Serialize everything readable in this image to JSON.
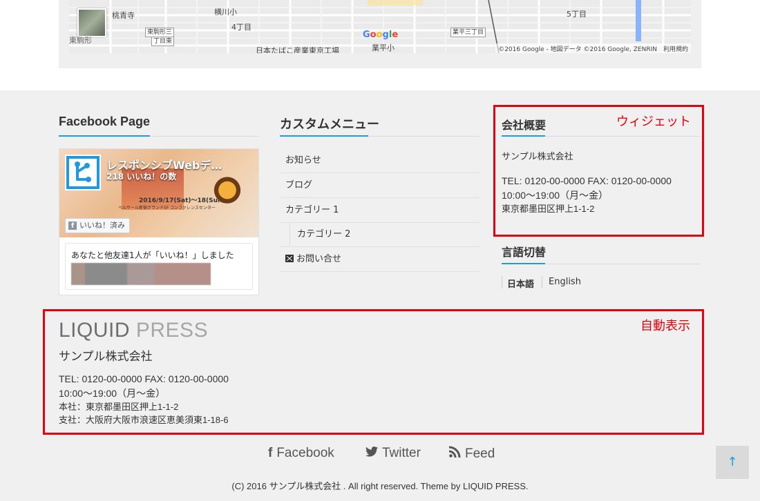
{
  "map": {
    "labels": {
      "momoaoji": "桃青寺",
      "yokokawa_sho": "横川小",
      "higashikomagata3": "東駒形三",
      "chome_higashi": "丁目東",
      "yonchome": "4丁目",
      "higashikomagata": "東駒形",
      "tobacco_factory": "日本たばこ産業東京工場",
      "gyohei_sho": "業平小",
      "gohchome": "5丁目",
      "gyohei3": "業平三丁目"
    },
    "google_logo": "Google",
    "copyright": "©2016 Google - 地図データ ©2016 Google, ZENRIN　利用規約",
    "zoom_in": "+",
    "zoom_out": "−"
  },
  "facebook_widget": {
    "title": "Facebook Page",
    "page_name": "レスポンシブWebデ…",
    "likes": "218 いいね！の数",
    "event_date": "2016/9/17(Sat)～18(Sun)",
    "event_venue": "ベルサール新宿グランド5F コンファレンスセンター",
    "like_button": "いいね！済み",
    "friends_text": "あなたと他友達1人が「いいね！」しました"
  },
  "custom_menu": {
    "title": "カスタムメニュー",
    "items": [
      "お知らせ",
      "ブログ",
      "カテゴリー 1",
      "カテゴリー 2",
      "お問い合せ"
    ]
  },
  "company_widget": {
    "title": "会社概要",
    "name": "サンプル株式会社",
    "tel_fax": "TEL: 0120-00-0000 FAX: 0120-00-0000",
    "hours": "10:00〜19:00（月〜金）",
    "address": "東京都墨田区押上1-1-2",
    "annotation": "ウィジェット"
  },
  "language_widget": {
    "title": "言語切替",
    "languages": [
      "日本語",
      "English"
    ]
  },
  "auto_display": {
    "annotation": "自動表示",
    "logo_part1": "LIQUID",
    "logo_part2": "PRESS",
    "company_name": "サンプル株式会社",
    "tel_fax": "TEL: 0120-00-0000 FAX: 0120-00-0000",
    "hours": "10:00〜19:00（月〜金）",
    "head_office": "本社：東京都墨田区押上1-1-2",
    "branch_office": "支社：大阪府大阪市浪速区恵美須東1-18-6"
  },
  "social": {
    "facebook": "Facebook",
    "twitter": "Twitter",
    "feed": "Feed"
  },
  "footer": {
    "copyright": "(C) 2016 サンプル株式会社 . All right reserved. Theme by LIQUID PRESS.",
    "pagetop": "↑"
  },
  "colors": {
    "accent": "#1e9be0",
    "annotation_red": "#e8000b",
    "footer_bg": "#f0f0f0"
  }
}
